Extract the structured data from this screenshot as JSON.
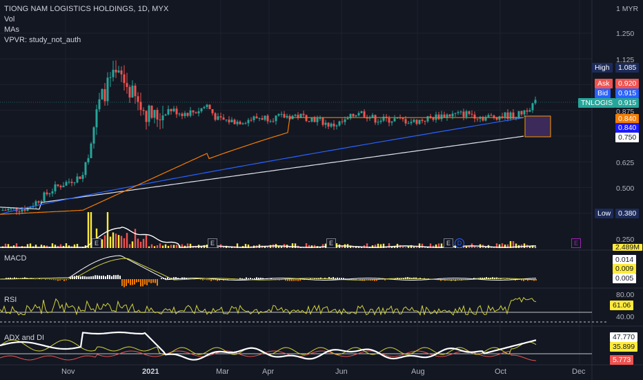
{
  "header": {
    "title": "TIONG NAM LOGISTICS HOLDINGS, 1D, MYX",
    "indicators": [
      "Vol",
      "MAs",
      "VPVR: study_not_auth"
    ],
    "currency": "1 MYR"
  },
  "price_axis": {
    "ticks": [
      "1.250",
      "1.125",
      "0.875",
      "0.625",
      "0.500",
      "0.250"
    ],
    "tags": {
      "high_label": "High",
      "high_value": "1.085",
      "ask_label": "Ask",
      "ask_value": "0.920",
      "bid_label": "Bid",
      "bid_value": "0.915",
      "symbol_label": "TNLOGIS",
      "symbol_value": "0.915",
      "ma_orange": "0.840",
      "ma_blue": "0.840",
      "ma_white": "0.750",
      "low_label": "Low",
      "low_value": "0.380",
      "volume_value": "2.489M"
    }
  },
  "panes": {
    "macd": {
      "label": "MACD",
      "values": [
        "0.014",
        "0.009",
        "0.005"
      ]
    },
    "rsi": {
      "label": "RSI",
      "ticks": [
        "80.00",
        "40.00"
      ],
      "value": "61.06"
    },
    "adx": {
      "label": "ADX and DI",
      "values": [
        "47.770",
        "35.899",
        "5.773"
      ]
    }
  },
  "x_axis": {
    "labels": [
      "Nov",
      "2021",
      "Mar",
      "Apr",
      "Jun",
      "Aug",
      "Oct",
      "Dec"
    ]
  },
  "events": [
    "E",
    "E",
    "E",
    "E",
    "D",
    "E"
  ],
  "colors": {
    "background": "#131722",
    "up": "#26a69a",
    "down": "#ef5350",
    "ma_orange": "#f57c00",
    "ma_blue": "#2962ff",
    "ma_white": "#e0e3eb",
    "rsi_line": "#d4d43a",
    "volume_up": "#ffeb3b",
    "volume_down": "#ef5350"
  },
  "chart_data": {
    "type": "candlestick",
    "symbol": "TIONG NAM LOGISTICS HOLDINGS",
    "interval": "1D",
    "exchange": "MYX",
    "x_labels": [
      "Nov",
      "2021",
      "Mar",
      "Apr",
      "Jun",
      "Aug",
      "Oct",
      "Dec"
    ],
    "price_ticks": [
      1.25,
      1.125,
      0.875,
      0.625,
      0.5,
      0.25
    ],
    "price_close_path": [
      [
        "Oct 2020 early",
        0.39
      ],
      [
        "Oct 2020 mid",
        0.4
      ],
      [
        "Oct 2020 late",
        0.48
      ],
      [
        "Nov",
        0.55
      ],
      [
        "Nov mid",
        0.75
      ],
      [
        "Nov late",
        1.0
      ],
      [
        "Dec early",
        1.05
      ],
      [
        "Dec mid",
        0.95
      ],
      [
        "2021",
        0.88
      ],
      [
        "Jan late",
        0.9
      ],
      [
        "Feb",
        0.87
      ],
      [
        "Mar",
        0.85
      ],
      [
        "Apr",
        0.86
      ],
      [
        "May",
        0.82
      ],
      [
        "Jun",
        0.86
      ],
      [
        "Jul",
        0.85
      ],
      [
        "Aug",
        0.86
      ],
      [
        "Sep",
        0.87
      ],
      [
        "Oct",
        0.87
      ],
      [
        "Oct late",
        0.915
      ]
    ],
    "moving_averages": [
      {
        "name": "MA orange",
        "last": 0.84
      },
      {
        "name": "MA blue",
        "last": 0.84
      },
      {
        "name": "MA white",
        "last": 0.75
      }
    ],
    "high": 1.085,
    "low": 0.38,
    "ask": 0.92,
    "bid": 0.915,
    "last": 0.915,
    "volume_last": "2.489M",
    "macd_last": [
      0.014,
      0.009,
      0.005
    ],
    "rsi_last": 61.06,
    "rsi_levels": [
      80,
      40
    ],
    "adx_last": [
      47.77,
      35.899,
      5.773
    ]
  }
}
